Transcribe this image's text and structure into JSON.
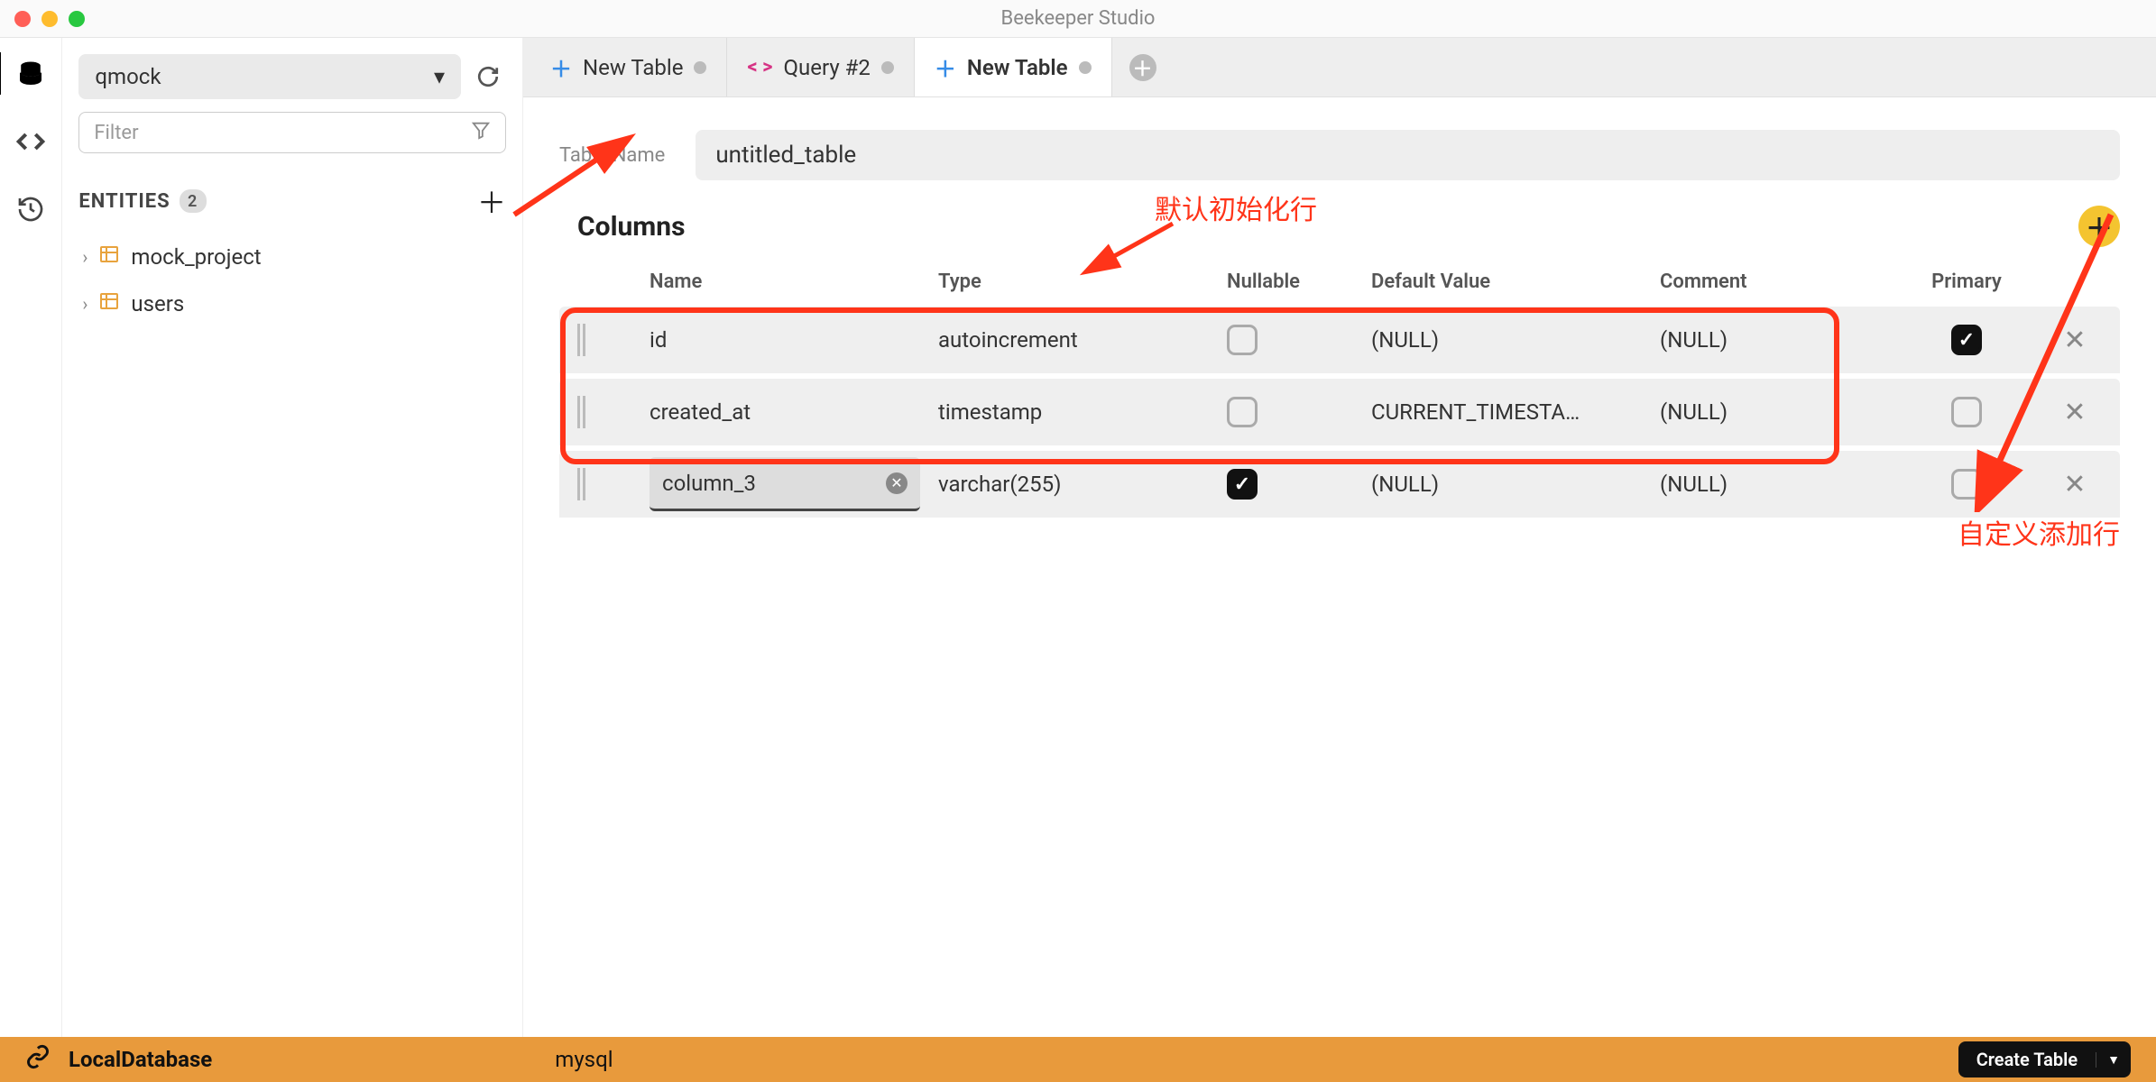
{
  "app_title": "Beekeeper Studio",
  "sidebar": {
    "db_selected": "qmock",
    "filter_placeholder": "Filter",
    "entities_label": "ENTITIES",
    "entities_count": "2",
    "entities": [
      {
        "name": "mock_project"
      },
      {
        "name": "users"
      }
    ]
  },
  "tabs": [
    {
      "label": "New Table",
      "icon": "plus",
      "active": false
    },
    {
      "label": "Query #2",
      "icon": "code",
      "active": false
    },
    {
      "label": "New Table",
      "icon": "plus",
      "active": true
    }
  ],
  "editor": {
    "table_name_label": "Table Name",
    "table_name_value": "untitled_table",
    "columns_title": "Columns",
    "headers": {
      "name": "Name",
      "type": "Type",
      "nullable": "Nullable",
      "default": "Default Value",
      "comment": "Comment",
      "primary": "Primary"
    },
    "rows": [
      {
        "name": "id",
        "type": "autoincrement",
        "nullable": false,
        "default": "(NULL)",
        "comment": "(NULL)",
        "primary": true,
        "editing": false
      },
      {
        "name": "created_at",
        "type": "timestamp",
        "nullable": false,
        "default": "CURRENT_TIMESTA…",
        "comment": "(NULL)",
        "primary": false,
        "editing": false
      },
      {
        "name": "column_3",
        "type": "varchar(255)",
        "nullable": true,
        "default": "(NULL)",
        "comment": "(NULL)",
        "primary": false,
        "editing": true
      }
    ]
  },
  "annotations": {
    "top": "默认初始化行",
    "bottom": "自定义添加行"
  },
  "footer": {
    "connection": "LocalDatabase",
    "db_type": "mysql",
    "create_label": "Create Table"
  }
}
